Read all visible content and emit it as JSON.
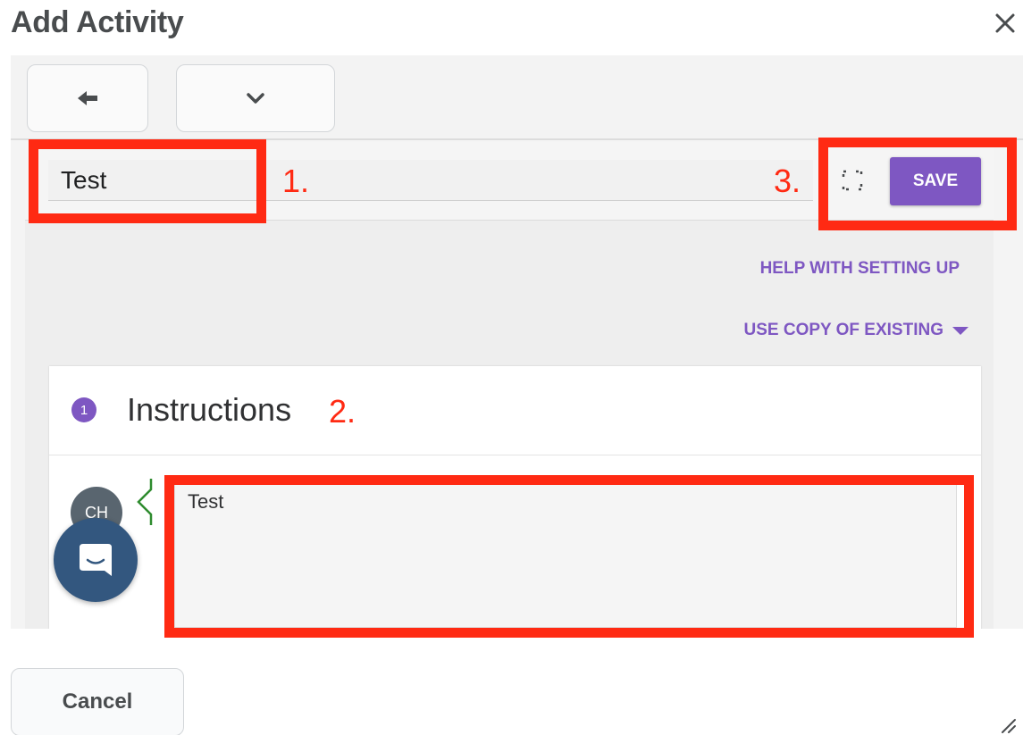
{
  "dialog": {
    "title": "Add Activity",
    "close_icon": "close-icon",
    "cancel_label": "Cancel"
  },
  "toolbar": {
    "back_icon": "arrow-left-icon",
    "menu_icon": "chevron-down-icon"
  },
  "header": {
    "title_value": "Test",
    "expand_icon": "fullscreen-icon",
    "save_label": "SAVE"
  },
  "links": {
    "help": "HELP WITH SETTING UP",
    "copy": "USE COPY OF EXISTING"
  },
  "instructions": {
    "step_number": "1",
    "title": "Instructions",
    "avatar_initials": "CH",
    "editor_text": "Test"
  },
  "annotations": {
    "label_1": "1.",
    "label_2": "2.",
    "label_3": "3.",
    "color": "#ff2a13"
  },
  "colors": {
    "accent": "#7e57c2",
    "chat_launcher": "#33577f",
    "avatar": "#59656f"
  },
  "chat": {
    "icon": "chat-bubble-icon"
  }
}
